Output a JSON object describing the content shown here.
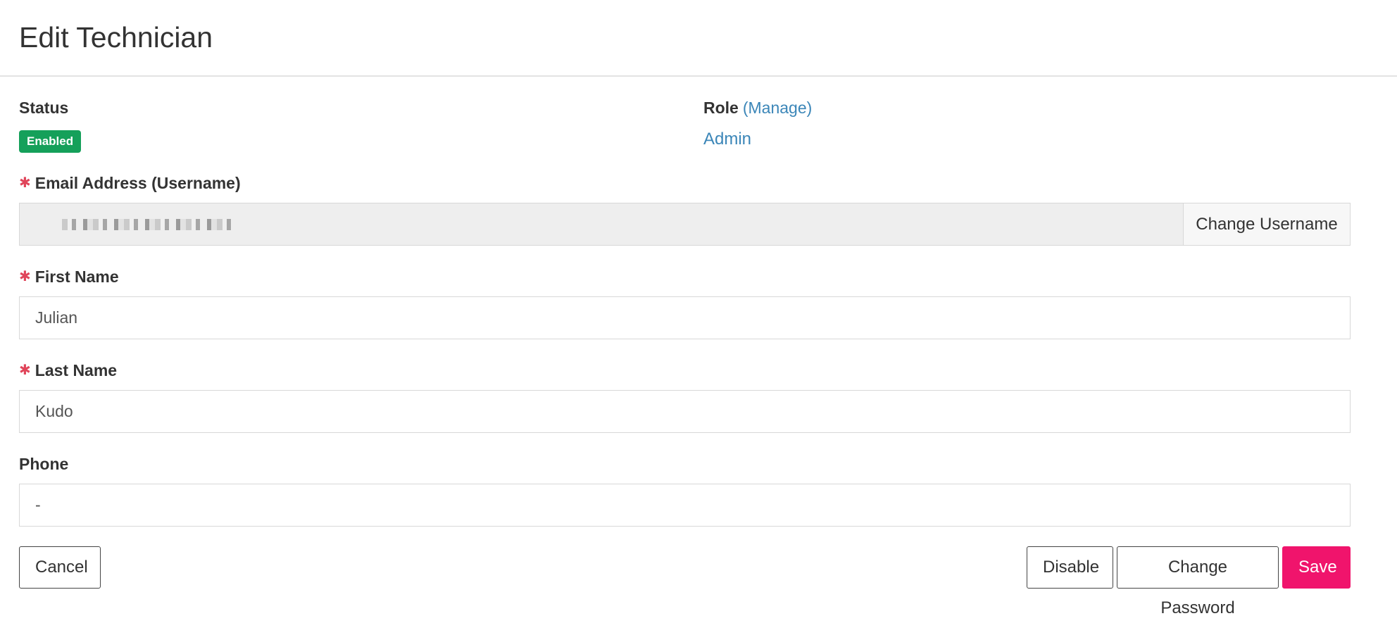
{
  "page": {
    "title": "Edit Technician"
  },
  "status": {
    "label": "Status",
    "badge": "Enabled",
    "badge_color": "#15a05a"
  },
  "role": {
    "label": "Role",
    "manage_link": "(Manage)",
    "value": "Admin",
    "link_color": "#3b86b8"
  },
  "form": {
    "email": {
      "label": "Email Address (Username)",
      "required": true,
      "value_redacted": true,
      "change_username_label": "Change Username"
    },
    "first_name": {
      "label": "First Name",
      "required": true,
      "value": "Julian"
    },
    "last_name": {
      "label": "Last Name",
      "required": true,
      "value": "Kudo"
    },
    "phone": {
      "label": "Phone",
      "required": false,
      "value": "-"
    },
    "required_marker": "✱",
    "required_color": "#e0455a"
  },
  "actions": {
    "cancel_label": "Cancel",
    "disable_label": "Disable",
    "change_password_label": "Change Password",
    "save_label": "Save",
    "save_color": "#f0146c"
  }
}
